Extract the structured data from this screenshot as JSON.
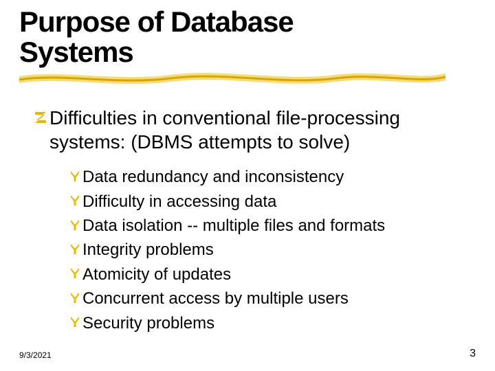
{
  "title_line1": "Purpose of Database",
  "title_line2": "Systems",
  "main": {
    "line1": "Difficulties in conventional file-processing",
    "line2": "systems: (DBMS attempts to solve)"
  },
  "subs": [
    "Data redundancy and inconsistency",
    "Difficulty in accessing data",
    "Data isolation -- multiple files and formats",
    "Integrity problems",
    "Atomicity of updates",
    "Concurrent access by multiple users",
    "Security problems"
  ],
  "footer": {
    "date": "9/3/2021",
    "page": "3"
  },
  "colors": {
    "bullet": "#e8b800",
    "underline_light": "#f6e08a",
    "underline_dark": "#d9a400"
  }
}
